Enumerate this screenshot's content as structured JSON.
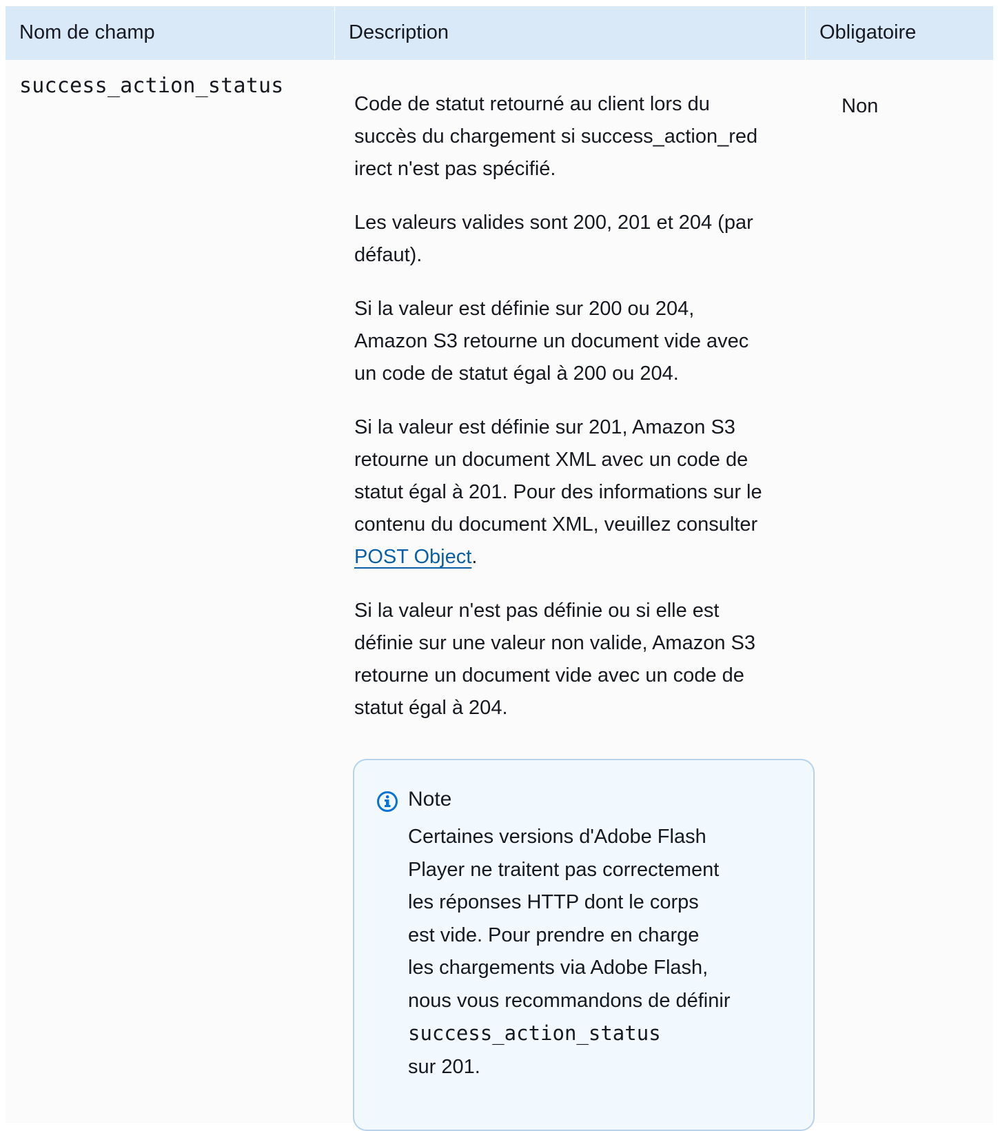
{
  "table": {
    "headers": {
      "field": "Nom de champ",
      "description": "Description",
      "required": "Obligatoire"
    },
    "row": {
      "field_name": "success_action_status",
      "description": {
        "p1_line1": "Code de statut retourné au client lors du",
        "p1_line2": "succès du chargement si success_action_red",
        "p1_line3": "irect n'est pas spécifié.",
        "p2_line1": "Les valeurs valides sont 200, 201 et 204 (par",
        "p2_line2": "défaut).",
        "p3_line1": "Si la valeur est définie sur 200 ou 204,",
        "p3_line2": "Amazon S3 retourne un document vide avec",
        "p3_line3": "un code de statut égal à 200 ou 204.",
        "p4_line1": "Si la valeur est définie sur 201, Amazon S3",
        "p4_line2": "retourne un document XML avec un code de",
        "p4_line3": "statut égal à 201. Pour des informations sur le",
        "p4_line4": "contenu du document XML, veuillez consulter",
        "p4_link": "POST Object",
        "p4_end": ".",
        "p5_line1": "Si la valeur n'est pas définie ou si elle est",
        "p5_line2": "définie sur une valeur non valide, Amazon S3",
        "p5_line3": "retourne un document vide avec un code de",
        "p5_line4": "statut égal à 204."
      },
      "required": "Non"
    }
  },
  "note": {
    "icon": "info-icon",
    "title": "Note",
    "line1": "Certaines versions d'Adobe Flash",
    "line2": "Player ne traitent pas correctement",
    "line3": "les réponses HTTP dont le corps",
    "line4": "est vide. Pour prendre en charge",
    "line5": "les chargements via Adobe Flash,",
    "line6": "nous vous recommandons de définir",
    "code": "success_action_status",
    "line7": "sur 201."
  },
  "colors": {
    "header_bg": "#d9e9f8",
    "note_bg": "#f1f8fe",
    "note_border": "#b7d2ea",
    "link": "#0a5fa6",
    "icon": "#0972d3"
  }
}
